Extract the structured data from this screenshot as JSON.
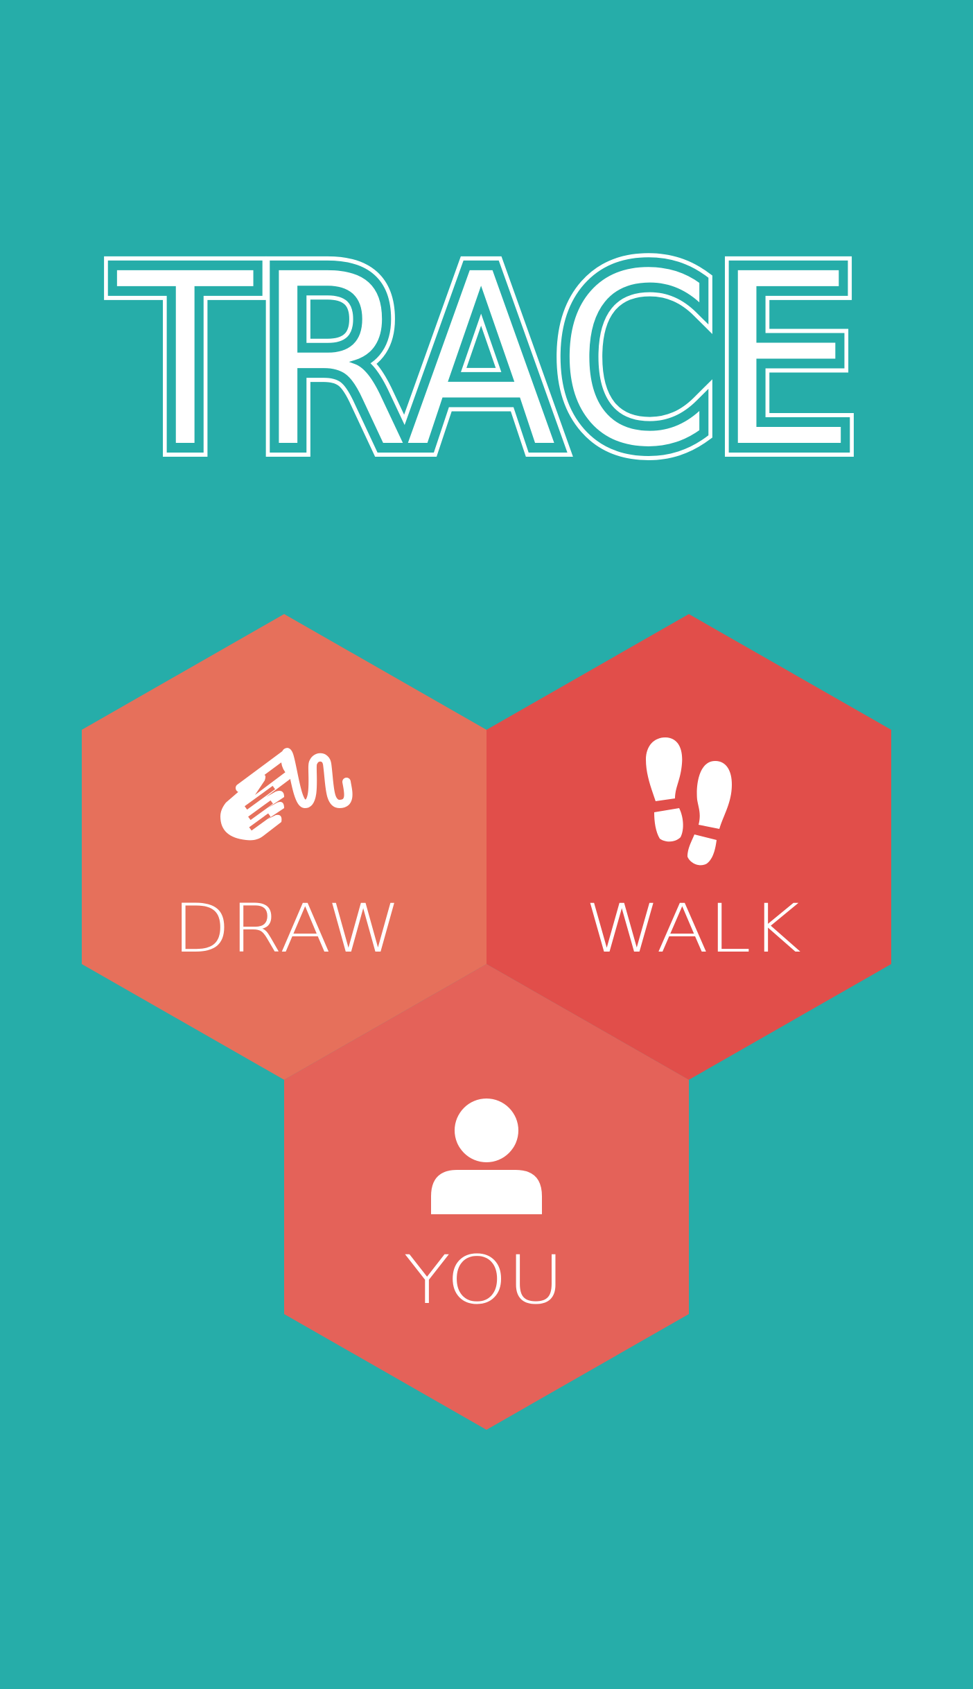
{
  "app": {
    "title": "TRACE",
    "background_color": "#26ADA9"
  },
  "menu": {
    "items": [
      {
        "id": "draw",
        "label": "DRAW",
        "icon": "draw-gesture-icon",
        "color": "#E6705B"
      },
      {
        "id": "walk",
        "label": "WALK",
        "icon": "footprints-icon",
        "color": "#E14E4A"
      },
      {
        "id": "you",
        "label": "YOU",
        "icon": "person-icon",
        "color": "#E46259"
      }
    ]
  },
  "text_color": "#FFFFFF"
}
